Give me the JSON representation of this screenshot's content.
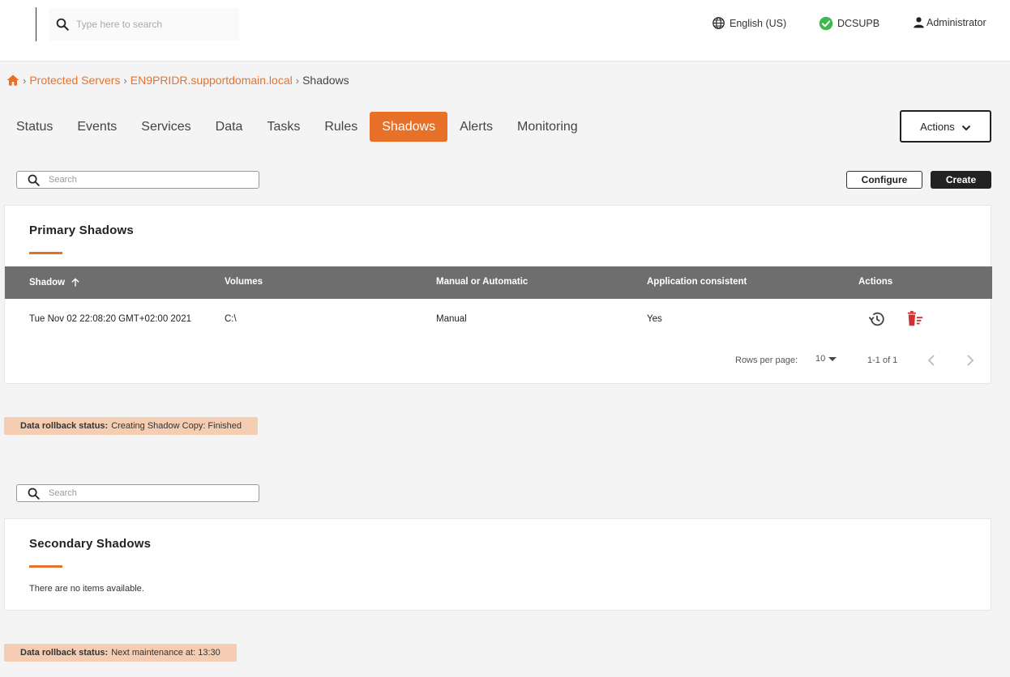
{
  "topbar": {
    "search_placeholder": "Type here to search",
    "language": "English (US)",
    "server": "DCSUPB",
    "user": "Administrator"
  },
  "breadcrumb": {
    "items": [
      "Protected Servers",
      "EN9PRIDR.supportdomain.local"
    ],
    "current": "Shadows"
  },
  "tabs": [
    {
      "label": "Status"
    },
    {
      "label": "Events"
    },
    {
      "label": "Services"
    },
    {
      "label": "Data"
    },
    {
      "label": "Tasks"
    },
    {
      "label": "Rules"
    },
    {
      "label": "Shadows",
      "active": true
    },
    {
      "label": "Alerts"
    },
    {
      "label": "Monitoring"
    }
  ],
  "actions_label": "Actions",
  "toolbar": {
    "search_placeholder": "Search",
    "configure_label": "Configure",
    "create_label": "Create"
  },
  "primary": {
    "title": "Primary Shadows",
    "columns": [
      "Shadow",
      "Volumes",
      "Manual or Automatic",
      "Application consistent",
      "Actions"
    ],
    "rows": [
      {
        "shadow": "Tue Nov 02 22:08:20 GMT+02:00 2021",
        "volumes": "C:\\",
        "mode": "Manual",
        "consistent": "Yes"
      }
    ],
    "rows_per_page_label": "Rows per page:",
    "rows_per_page": "10",
    "range": "1-1 of 1"
  },
  "status1": {
    "label": "Data rollback status:",
    "text": "Creating Shadow Copy: Finished"
  },
  "secondary": {
    "search_placeholder": "Search",
    "title": "Secondary Shadows",
    "empty": "There are no items available."
  },
  "status2": {
    "label": "Data rollback status:",
    "text": "Next maintenance at: 13:30"
  },
  "colors": {
    "accent": "#e8712a",
    "header": "#6e6e6e",
    "badge": "#f5cdb3",
    "ok": "#3dba4e",
    "delete": "#d32f2f"
  }
}
